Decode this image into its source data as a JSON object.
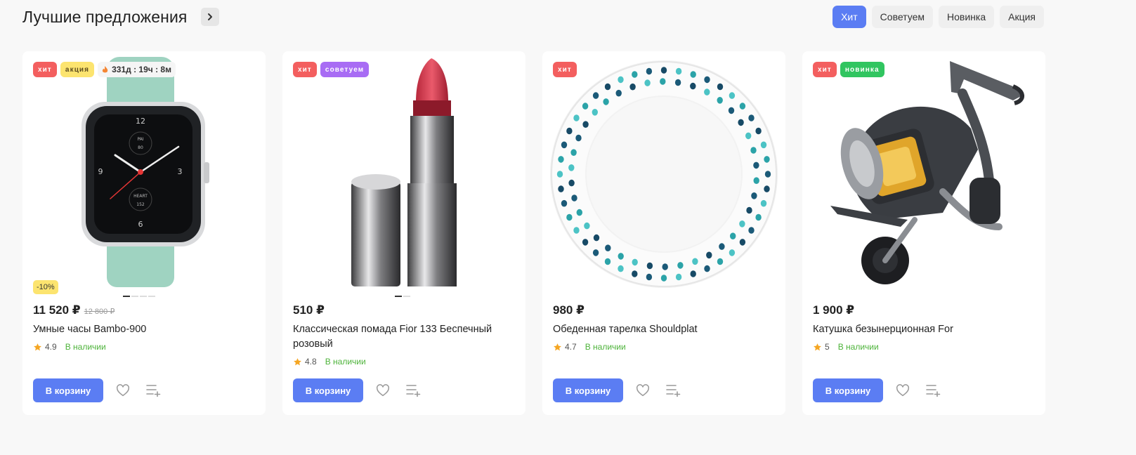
{
  "header": {
    "title": "Лучшие предложения",
    "filters": [
      "Хит",
      "Советуем",
      "Новинка",
      "Акция"
    ],
    "active_filter": "Хит"
  },
  "colors": {
    "accent": "#5b7df3",
    "badge_hit": "#f35f5f",
    "badge_promo": "#fce46f",
    "badge_recommended": "#a86cf4",
    "badge_new": "#31c560",
    "in_stock": "#4db33a",
    "star": "#f5a623"
  },
  "products": [
    {
      "badges": [
        "хит",
        "акция"
      ],
      "timer": "331д : 19ч : 8м",
      "discount": "-10%",
      "price": "11 520 ₽",
      "old_price": "12 800 ₽",
      "name": "Умные часы Bambo-900",
      "rating": "4.9",
      "stock": "В наличии",
      "image_icon": "smartwatch-icon",
      "slider": {
        "count": 4,
        "active": 1
      }
    },
    {
      "badges": [
        "хит",
        "советуем"
      ],
      "price": "510 ₽",
      "name": "Классическая помада Fior 133 Беспечный розовый",
      "rating": "4.8",
      "stock": "В наличии",
      "image_icon": "lipstick-icon",
      "slider": {
        "count": 2,
        "active": 1
      }
    },
    {
      "badges": [
        "хит"
      ],
      "price": "980 ₽",
      "name": "Обеденная тарелка Shouldplat",
      "rating": "4.7",
      "stock": "В наличии",
      "image_icon": "plate-icon"
    },
    {
      "badges": [
        "хит",
        "новинка"
      ],
      "price": "1 900 ₽",
      "name": "Катушка безынерционная For",
      "rating": "5",
      "stock": "В наличии",
      "image_icon": "fishing-reel-icon"
    }
  ],
  "card_actions": {
    "cart_label": "В корзину",
    "favorite_icon": "heart-icon",
    "compare_icon": "compare-list-icon"
  },
  "watch_face": {
    "top": "12",
    "left": "9",
    "right": "3",
    "bottom": "6",
    "upper_label": "PAI",
    "lower_label": "HEART",
    "upper_value": "80",
    "lower_value": "152"
  }
}
